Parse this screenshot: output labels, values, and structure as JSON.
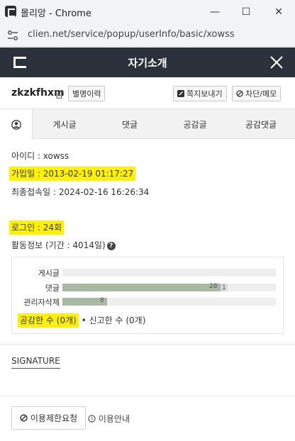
{
  "window": {
    "title": "몰리앙 - Chrome",
    "min_glyph": "—",
    "max_glyph": "☐",
    "close_glyph": "✕"
  },
  "address": {
    "url": "clien.net/service/popup/userInfo/basic/xowss"
  },
  "header": {
    "title": "자기소개"
  },
  "user": {
    "nickname": "zkzkfhxm",
    "suffix": "님",
    "nick_history_label": "별명이력",
    "message_label": "쪽지보내기",
    "block_label": "차단/메모"
  },
  "tabs": [
    "게시글",
    "댓글",
    "공감글",
    "공감댓글"
  ],
  "info": {
    "id_line": "아이디 : xowss",
    "joined_line": "가입일 : 2013-02-19 01:17:27",
    "last_access_line": "최종접속일 : 2024-02-16 16:26:34",
    "login_line": "로그인 : 24회",
    "activity_line": "활동정보 (기간 : 4014일)",
    "help_glyph": "?"
  },
  "stats": [
    {
      "label": "게시글",
      "value": 0,
      "fill": 0.0,
      "value_text": "",
      "extra_text": ""
    },
    {
      "label": "댓글",
      "value": 28,
      "fill": 0.74,
      "value_text": "28",
      "extra_text": "1"
    },
    {
      "label": "관리자삭제",
      "value": 8,
      "fill": 0.21,
      "value_text": "8",
      "extra_text": ""
    }
  ],
  "votes": {
    "like_text": "공감한 수 (0개)",
    "separator": "•",
    "report_text": "신고한 수 (0개)"
  },
  "signature": {
    "label": "SIGNATURE"
  },
  "footer": {
    "restrict_label": "이용제한요청",
    "guide_label": "이용안내"
  },
  "colors": {
    "header_bg": "#2b313b",
    "highlight": "#fff200",
    "bar_fill": "#a9b8a2"
  }
}
